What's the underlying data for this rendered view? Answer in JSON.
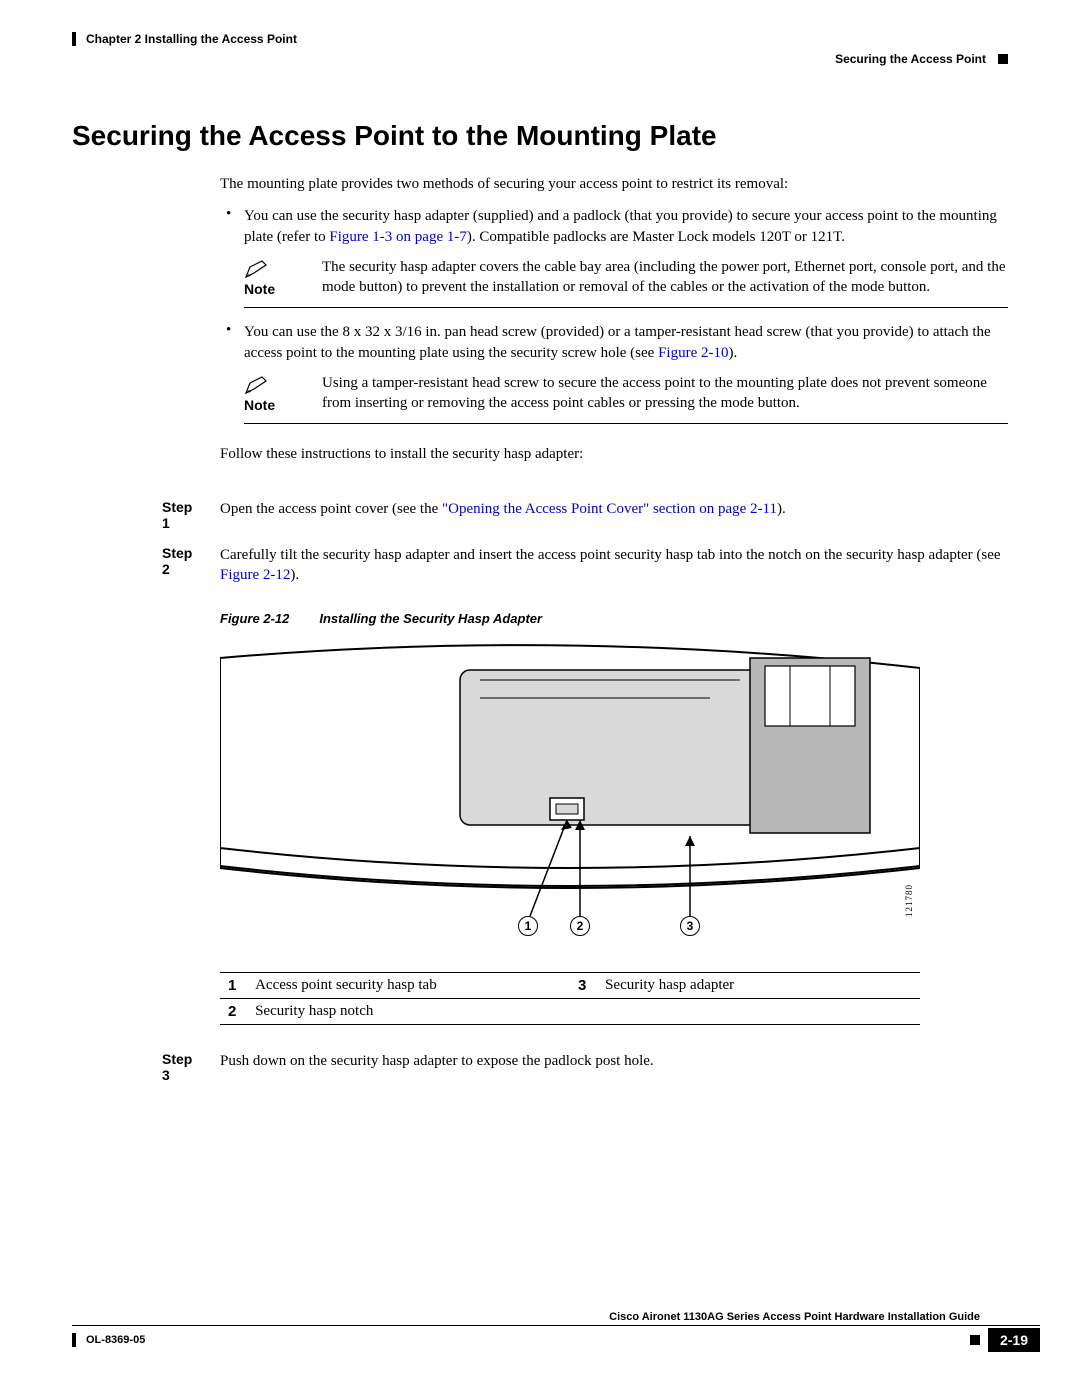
{
  "header": {
    "chapter": "Chapter 2      Installing the Access Point",
    "section": "Securing the Access Point"
  },
  "heading": "Securing the Access Point to the Mounting Plate",
  "intro": "The mounting plate provides two methods of securing your access point to restrict its removal:",
  "bullet1": {
    "pre": "You can use the security hasp adapter (supplied) and a padlock (that you provide) to secure your access point to the mounting plate (refer to ",
    "link": "Figure 1-3 on page 1-7",
    "post": "). Compatible padlocks are Master Lock models 120T or 121T."
  },
  "note1": {
    "label": "Note",
    "text": "The security hasp adapter covers the cable bay area (including the power port, Ethernet port, console port, and the mode button) to prevent the installation or removal of the cables or the activation of the mode button."
  },
  "bullet2": {
    "pre": "You can use the 8 x 32 x 3/16 in. pan head screw (provided) or a tamper-resistant head screw (that you provide) to attach the access point to the mounting plate using the security screw hole (see ",
    "link": "Figure 2-10",
    "post": ")."
  },
  "note2": {
    "label": "Note",
    "text": "Using a tamper-resistant head screw to secure the access point to the mounting plate does not prevent someone from inserting or removing the access point cables or pressing the mode button."
  },
  "follow": "Follow these instructions to install the security hasp adapter:",
  "steps": {
    "s1": {
      "label": "Step 1",
      "pre": "Open the access point cover (see the ",
      "link": "\"Opening the Access Point Cover\" section on page 2-11",
      "post": ")."
    },
    "s2": {
      "label": "Step 2",
      "pre": "Carefully tilt the security hasp adapter and insert the access point security hasp tab into the notch on the security hasp adapter (see ",
      "link": "Figure 2-12",
      "post": ")."
    },
    "s3": {
      "label": "Step 3",
      "text": "Push down on the security hasp adapter to expose the padlock post hole."
    }
  },
  "figure": {
    "num": "Figure 2-12",
    "title": "Installing the Security Hasp Adapter",
    "imgnum": "121780"
  },
  "callouts": {
    "c1": "1",
    "c2": "2",
    "c3": "3"
  },
  "legend": {
    "r1n": "1",
    "r1t": "Access point security hasp tab",
    "r2n": "2",
    "r2t": "Security hasp notch",
    "r3n": "3",
    "r3t": "Security hasp adapter"
  },
  "footer": {
    "guide": "Cisco Aironet 1130AG Series Access Point Hardware Installation Guide",
    "ol": "OL-8369-05",
    "page": "2-19"
  }
}
